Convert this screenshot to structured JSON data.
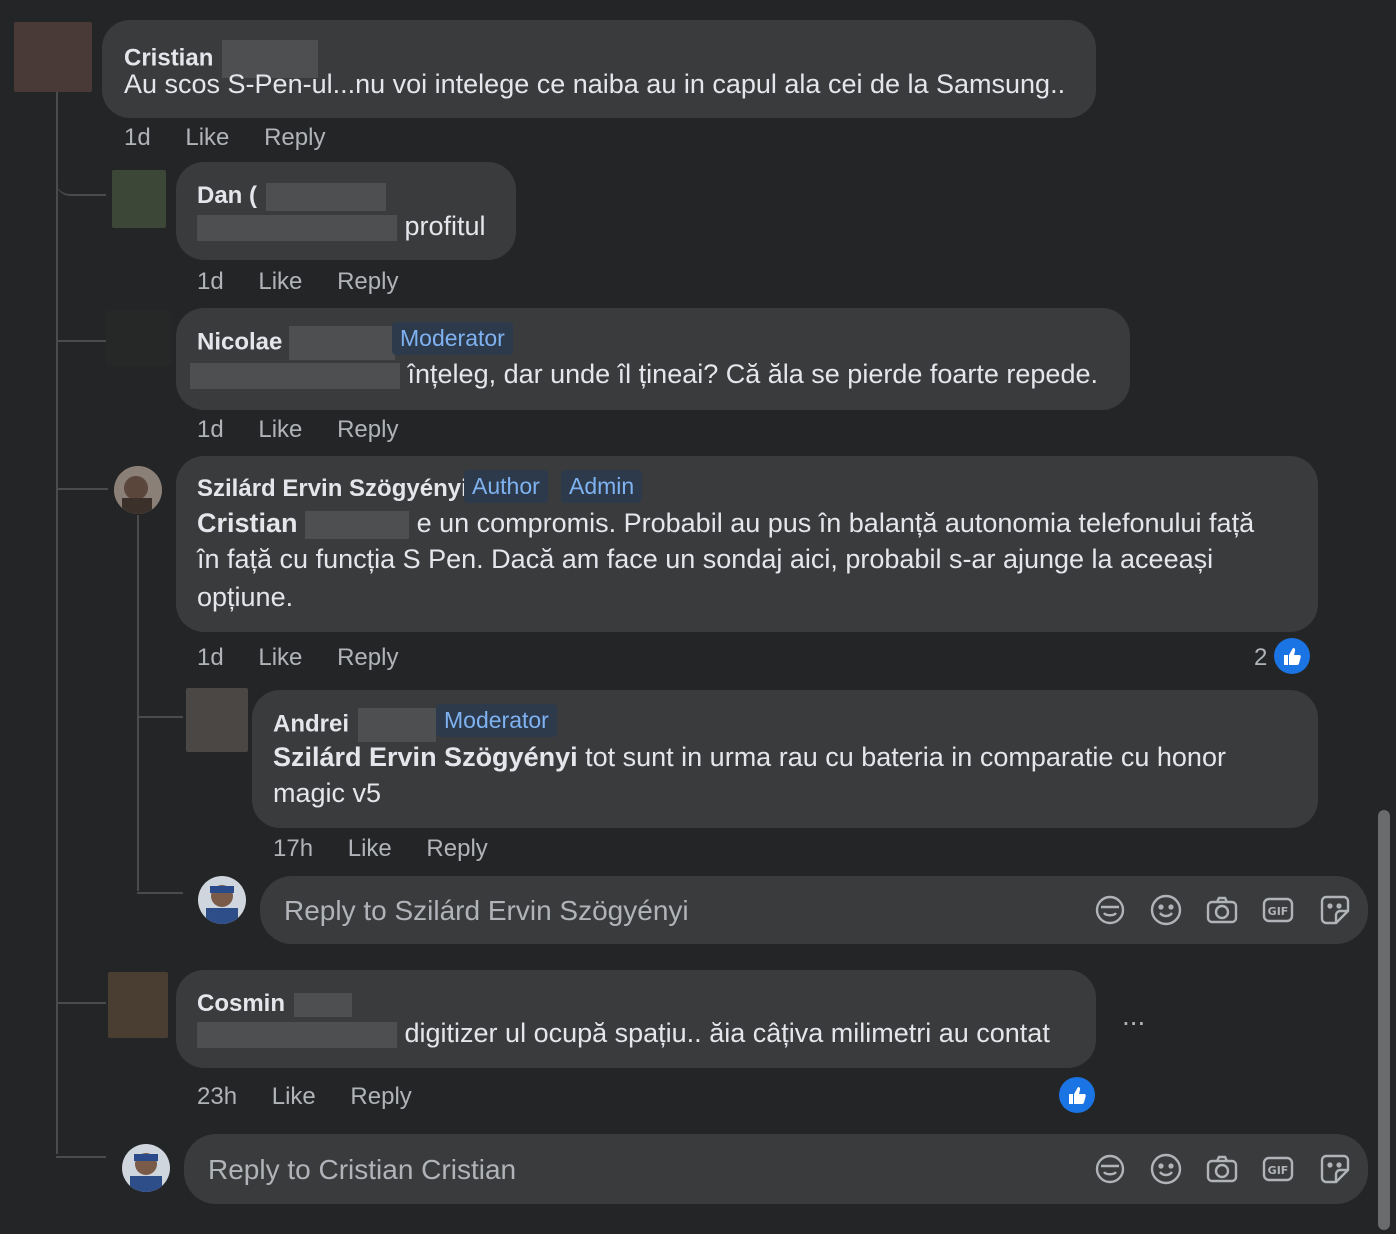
{
  "comments": [
    {
      "name": "Cristian",
      "text": "Au scos S-Pen-ul...nu voi intelege ce naiba au in capul ala cei de la Samsung..",
      "time": "1d",
      "like": "Like",
      "reply": "Reply"
    },
    {
      "name": "Dan (",
      "text": "profitul",
      "time": "1d",
      "like": "Like",
      "reply": "Reply"
    },
    {
      "name": "Nicolae",
      "badge": "Moderator",
      "text": "înțeleg, dar unde îl țineai? Că ăla se pierde foarte repede.",
      "time": "1d",
      "like": "Like",
      "reply": "Reply"
    },
    {
      "name": "Szilárd Ervin Szögyényi",
      "badges": [
        "Author",
        "Admin"
      ],
      "mention": "Cristian",
      "text_line1": "e un compromis. Probabil au pus în balanță autonomia telefonului față",
      "text_line2": "în față cu funcția S Pen. Dacă am face un sondaj aici, probabil s-ar ajunge la aceeași",
      "text_line3": "opțiune.",
      "time": "1d",
      "like": "Like",
      "reply": "Reply",
      "reactions": "2"
    },
    {
      "name": "Andrei",
      "badge": "Moderator",
      "mention": "Szilárd Ervin Szögyényi",
      "text_line1": "tot sunt in urma rau cu bateria in comparatie cu honor",
      "text_line2": "magic v5",
      "time": "17h",
      "like": "Like",
      "reply": "Reply"
    },
    {
      "name": "Cosmin",
      "text": "digitizer ul ocupă spațiu.. ăia câțiva milimetri au contat",
      "time": "23h",
      "like": "Like",
      "reply": "Reply",
      "more": "..."
    }
  ],
  "reply_boxes": [
    {
      "placeholder": "Reply to Szilárd Ervin Szögyényi"
    },
    {
      "placeholder": "Reply to Cristian Cristian"
    }
  ],
  "icons": [
    "avatar-sticker-icon",
    "emoji-icon",
    "camera-icon",
    "gif-icon",
    "sticker-icon"
  ],
  "colors": {
    "background": "#242526",
    "bubble": "#3a3b3c",
    "badge_text": "#7fb2f0",
    "like_blue": "#1b74e4"
  }
}
